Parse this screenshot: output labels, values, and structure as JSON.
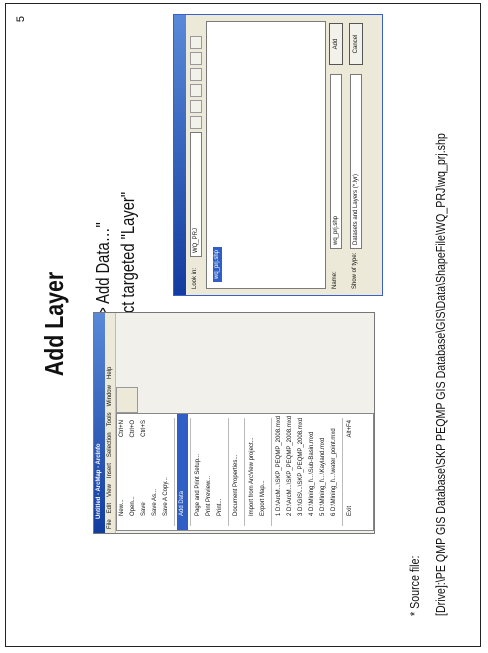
{
  "slide": {
    "page_number": "5",
    "title": "Add Layer",
    "bullet": "•",
    "step1": "Select \"File > Add Data…\"",
    "step2": "Then select targeted \"Layer\"",
    "source_label": "* Source file:",
    "source_path": "[Drive]:\\PE QMP GIS Database\\SKP PEQMP GIS Database\\GIS\\Data\\ShapeFile\\WQ_PRJ\\wq_prj.shp"
  },
  "arcmap": {
    "title": "Untitled - ArcMap - ArcInfo",
    "menus": [
      "File",
      "Edit",
      "View",
      "Insert",
      "Selection",
      "Tools",
      "Window",
      "Help"
    ],
    "file_menu": [
      {
        "label": "New...",
        "shortcut": "Ctrl+N"
      },
      {
        "label": "Open...",
        "shortcut": "Ctrl+O"
      },
      {
        "label": "Save",
        "shortcut": "Ctrl+S"
      },
      {
        "label": "Save As..."
      },
      {
        "label": "Save A Copy..."
      },
      {
        "label": "Add Data",
        "highlighted": true
      },
      {
        "label": "Page and Print Setup..."
      },
      {
        "label": "Print Preview..."
      },
      {
        "label": "Print..."
      },
      {
        "label": "Document Properties..."
      },
      {
        "label": "Import from ArcView project..."
      },
      {
        "label": "Export Map..."
      },
      {
        "label": "1 D:\\ArcM...\\SKP_PEQMP_2008.mxd"
      },
      {
        "label": "2 D:\\ArcM...\\SKP_PEQMP_2008.mxd"
      },
      {
        "label": "3 D:\\GIS\\...\\SKP_PEQMP_2008.mxd"
      },
      {
        "label": "4 D:\\Mining_I\\...\\Sub-Basin.mxd"
      },
      {
        "label": "5 D:\\Mining_I\\...\\Kayland.mxd"
      },
      {
        "label": "6 D:\\Mining_I\\...\\water_point.mxd"
      },
      {
        "label": "Exit",
        "shortcut": "Alt+F4"
      }
    ]
  },
  "add_data": {
    "look_in_label": "Look in:",
    "look_in_value": "WQ_PRJ",
    "selected_file": "wq_prj.shp",
    "name_label": "Name:",
    "name_value": "wq_prj.shp",
    "type_label": "Show of type:",
    "type_value": "Datasets and Layers (*.lyr)",
    "add_button": "Add",
    "cancel_button": "Cancel"
  }
}
